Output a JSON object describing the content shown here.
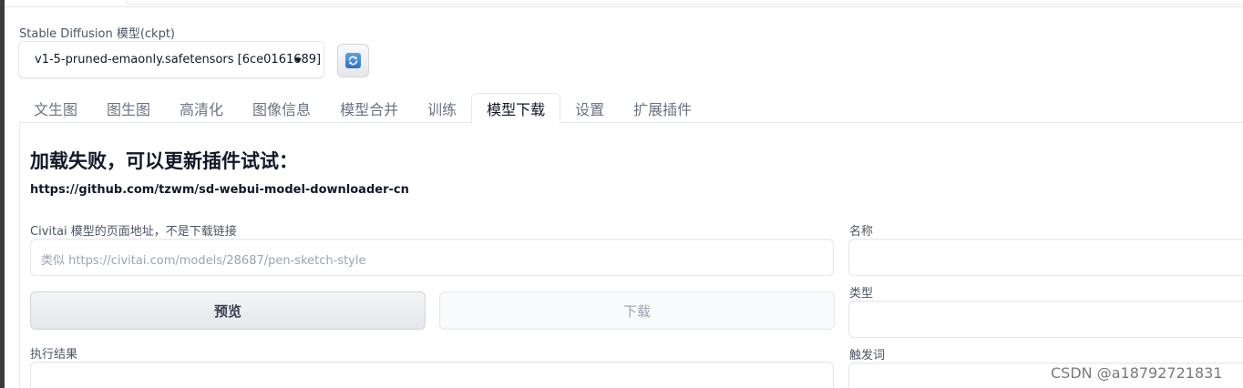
{
  "checkpoint": {
    "label": "Stable Diffusion 模型(ckpt)",
    "selected": "v1-5-pruned-emaonly.safetensors [6ce0161689]"
  },
  "tabs": [
    {
      "label": "文生图"
    },
    {
      "label": "图生图"
    },
    {
      "label": "高清化"
    },
    {
      "label": "图像信息"
    },
    {
      "label": "模型合并"
    },
    {
      "label": "训练"
    },
    {
      "label": "模型下载",
      "active": true
    },
    {
      "label": "设置"
    },
    {
      "label": "扩展插件"
    }
  ],
  "panel": {
    "heading": "加载失败，可以更新插件试试：",
    "repo_url": "https://github.com/tzwm/sd-webui-model-downloader-cn",
    "civitai_label": "Civitai 模型的页面地址，不是下载链接",
    "civitai_placeholder": "类似 https://civitai.com/models/28687/pen-sketch-style",
    "preview_button": "预览",
    "download_button": "下载",
    "result_label": "执行结果",
    "name_label": "名称",
    "type_label": "类型",
    "trigger_label": "触发词"
  },
  "watermark": "CSDN @a18792721831",
  "icons": {
    "refresh": "refresh-icon",
    "dropdown": "chevron-down-icon"
  },
  "colors": {
    "border": "#e5e7eb",
    "text": "#111827",
    "muted": "#6b7280",
    "refresh_accent": "#2d6fc4"
  }
}
